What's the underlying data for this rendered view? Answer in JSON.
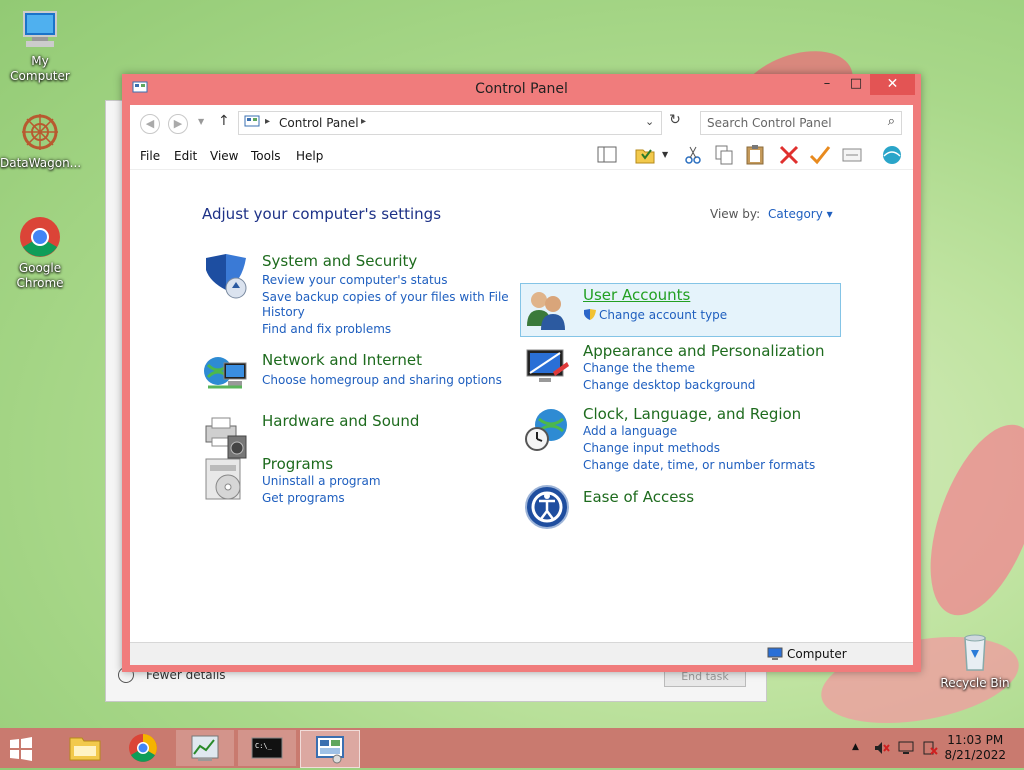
{
  "desktop": {
    "icons": [
      {
        "label": "My Computer",
        "icon": "computer-icon"
      },
      {
        "label": "DataWagon...",
        "icon": "datawagon-icon"
      },
      {
        "label": "Google Chrome",
        "icon": "chrome-icon"
      },
      {
        "label": "Recycle Bin",
        "icon": "recycle-bin-icon"
      }
    ]
  },
  "background_window": {
    "label": "Fewer details",
    "button": "End task"
  },
  "window": {
    "title": "Control Panel",
    "controls": {
      "minimize": "–",
      "maximize": "□",
      "close": "✕"
    }
  },
  "address": {
    "crumb": "Control Panel",
    "search_placeholder": "Search Control Panel"
  },
  "menu": [
    "File",
    "Edit",
    "View",
    "Tools",
    "Help"
  ],
  "content": {
    "heading": "Adjust your computer's settings",
    "view_by_label": "View by:",
    "view_by_value": "Category ▾",
    "categories": [
      {
        "title": "System and Security",
        "icon": "shield-icon",
        "links": [
          "Review your computer's status",
          "Save backup copies of your files with File",
          "History",
          "Find and fix problems"
        ]
      },
      {
        "title": "Network and Internet",
        "icon": "network-globe-icon",
        "links": [
          "Choose homegroup and sharing options"
        ]
      },
      {
        "title": "Hardware and Sound",
        "icon": "printer-speaker-icon",
        "links": []
      },
      {
        "title": "Programs",
        "icon": "programs-disc-icon",
        "links": [
          "Uninstall a program",
          "Get programs"
        ]
      },
      {
        "title": "User Accounts",
        "icon": "users-icon",
        "links": [
          "Change account type"
        ]
      },
      {
        "title": "Appearance and Personalization",
        "icon": "monitor-paint-icon",
        "links": [
          "Change the theme",
          "Change desktop background"
        ]
      },
      {
        "title": "Clock, Language, and Region",
        "icon": "clock-globe-icon",
        "links": [
          "Add a language",
          "Change input methods",
          "Change date, time, or number formats"
        ]
      },
      {
        "title": "Ease of Access",
        "icon": "ease-of-access-icon",
        "links": []
      }
    ]
  },
  "statusbar": {
    "text": "Computer"
  },
  "taskbar": {
    "time": "11:03 PM",
    "date": "8/21/2022"
  },
  "colors": {
    "window_frame": "#f07c7c",
    "link_blue": "#1f5fbf",
    "category_green": "#1e6b1e",
    "heading_blue": "#1e3287",
    "highlight_bg": "#e5f3fb",
    "taskbar": "#c97a6f"
  }
}
